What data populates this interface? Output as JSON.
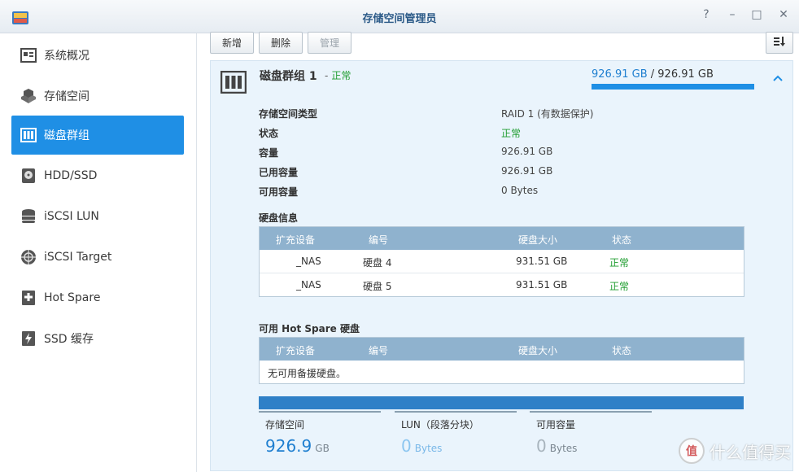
{
  "window": {
    "title": "存储空间管理员",
    "buttons": [
      "?",
      "–",
      "□",
      "✕"
    ]
  },
  "sidebar": {
    "items": [
      {
        "label": "系统概况",
        "icon": "overview-icon"
      },
      {
        "label": "存储空间",
        "icon": "volume-cubes-icon"
      },
      {
        "label": "磁盘群组",
        "icon": "disk-group-icon",
        "active": true
      },
      {
        "label": "HDD/SSD",
        "icon": "hdd-icon"
      },
      {
        "label": "iSCSI LUN",
        "icon": "database-icon"
      },
      {
        "label": "iSCSI Target",
        "icon": "target-globe-icon"
      },
      {
        "label": "Hot Spare",
        "icon": "hot-spare-plus-icon"
      },
      {
        "label": "SSD 缓存",
        "icon": "ssd-cache-bolt-icon"
      }
    ]
  },
  "toolbar": {
    "create": "新增",
    "delete": "删除",
    "manage": "管理"
  },
  "disk_group": {
    "title": "磁盘群组 1",
    "status": "正常",
    "usage_used": "926.91 GB",
    "usage_total": "926.91 GB",
    "usage_fraction": 1.0,
    "properties": [
      {
        "key": "存储空间类型",
        "value": "RAID 1 (有数据保护)"
      },
      {
        "key": "状态",
        "value": "正常"
      },
      {
        "key": "容量",
        "value": "926.91 GB"
      },
      {
        "key": "已用容量",
        "value": "926.91 GB"
      },
      {
        "key": "可用容量",
        "value": "0 Bytes"
      }
    ]
  },
  "disk_info": {
    "title": "硬盘信息",
    "columns": [
      "扩充设备",
      "编号",
      "硬盘大小",
      "状态"
    ],
    "rows": [
      {
        "device": "_NAS",
        "number": "硬盘 4",
        "size": "931.51 GB",
        "status": "正常"
      },
      {
        "device": "_NAS",
        "number": "硬盘 5",
        "size": "931.51 GB",
        "status": "正常"
      }
    ]
  },
  "hot_spare": {
    "title": "可用 Hot Spare 硬盘",
    "columns": [
      "扩充设备",
      "编号",
      "硬盘大小",
      "状态"
    ],
    "empty_text": "无可用备援硬盘。"
  },
  "summary": {
    "storage": {
      "label": "存储空间",
      "value": "926.9",
      "unit": "GB"
    },
    "lun": {
      "label": "LUN（段落分块）",
      "value": "0",
      "unit": "Bytes"
    },
    "available": {
      "label": "可用容量",
      "value": "0",
      "unit": "Bytes"
    }
  },
  "watermark": {
    "glyph": "值",
    "text": "什么值得买"
  },
  "colors": {
    "accent": "#1f8fe5",
    "normal": "#1d9c2e",
    "table_header": "#8fb2ce"
  }
}
